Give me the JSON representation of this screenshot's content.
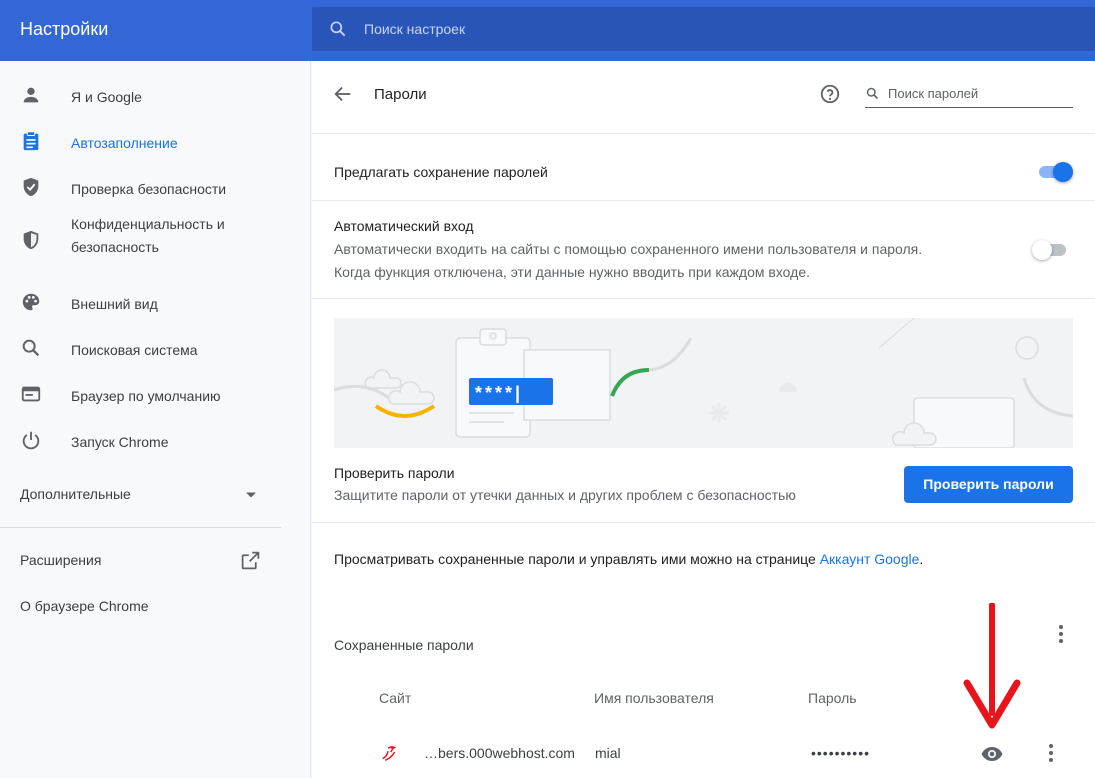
{
  "header": {
    "title": "Настройки",
    "search_placeholder": "Поиск настроек"
  },
  "sidebar": {
    "items": [
      {
        "label": "Я и Google",
        "icon": "person-icon"
      },
      {
        "label": "Автозаполнение",
        "icon": "clipboard-icon",
        "active": true
      },
      {
        "label": "Проверка безопасности",
        "icon": "shield-check-icon"
      },
      {
        "label": "Конфиденциальность и безопасность",
        "icon": "shield-icon"
      },
      {
        "label": "Внешний вид",
        "icon": "palette-icon"
      },
      {
        "label": "Поисковая система",
        "icon": "search-icon"
      },
      {
        "label": "Браузер по умолчанию",
        "icon": "browser-icon"
      },
      {
        "label": "Запуск Chrome",
        "icon": "power-icon"
      }
    ],
    "advanced_label": "Дополнительные",
    "extensions_label": "Расширения",
    "about_label": "О браузере Chrome"
  },
  "main": {
    "title": "Пароли",
    "search_placeholder": "Поиск паролей",
    "offer_save": {
      "label": "Предлагать сохранение паролей",
      "enabled": true
    },
    "auto_signin": {
      "label": "Автоматический вход",
      "desc_line1": "Автоматически входить на сайты с помощью сохраненного имени пользователя и пароля.",
      "desc_line2": "Когда функция отключена, эти данные нужно вводить при каждом входе.",
      "enabled": false
    },
    "illustration_text": "****|",
    "check": {
      "title": "Проверить пароли",
      "desc": "Защитите пароли от утечки данных и других проблем с безопасностью",
      "button": "Проверить пароли"
    },
    "manage": {
      "text": "Просматривать сохраненные пароли и управлять ими можно на странице ",
      "link": "Аккаунт Google",
      "suffix": "."
    },
    "saved": {
      "title": "Сохраненные пароли",
      "columns": {
        "site": "Сайт",
        "username": "Имя пользователя",
        "password": "Пароль"
      },
      "rows": [
        {
          "site": "…bers.000webhost.com",
          "username": "mial",
          "password": "••••••••••"
        }
      ]
    }
  },
  "colors": {
    "header": "#3367d6",
    "accent": "#1a73e8",
    "annotation_arrow": "#e8141b"
  }
}
